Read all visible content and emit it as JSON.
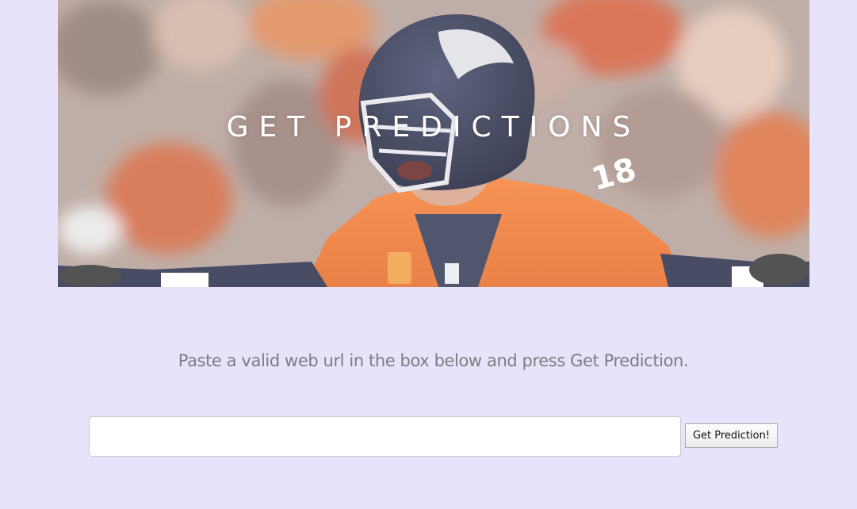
{
  "hero": {
    "title": "GET PREDICTIONS",
    "image_description_icon": "football-player-photo"
  },
  "form": {
    "instructions": "Paste a valid web url in the box below and press Get Prediction.",
    "url_input_value": "",
    "url_input_placeholder": "",
    "submit_label": "Get Prediction!"
  },
  "colors": {
    "background": "#e6e3fa",
    "text_muted": "#7d7d80",
    "jersey_orange": "#f0793a",
    "helmet_navy": "#2b2f4a"
  }
}
